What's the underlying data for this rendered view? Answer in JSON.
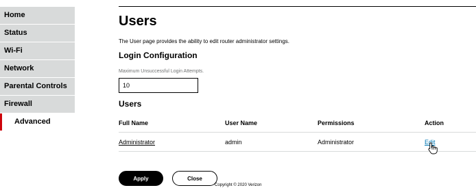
{
  "sidebar": {
    "items": [
      {
        "label": "Home"
      },
      {
        "label": "Status"
      },
      {
        "label": "Wi-Fi"
      },
      {
        "label": "Network"
      },
      {
        "label": "Parental Controls"
      },
      {
        "label": "Firewall"
      },
      {
        "label": "Advanced",
        "active": true
      }
    ]
  },
  "page": {
    "title": "Users",
    "description": "The User page provides the ability to edit router administrator settings."
  },
  "login_config": {
    "heading": "Login Configuration",
    "attempts_label": "Maximum Unsuccessful Login Attempts.",
    "attempts_value": "10"
  },
  "users": {
    "heading": "Users",
    "columns": [
      "Full Name",
      "User Name",
      "Permissions",
      "Action"
    ],
    "rows": [
      {
        "full_name": "Administrator",
        "user_name": "admin",
        "permissions": "Administrator",
        "action": "Edit"
      }
    ]
  },
  "buttons": {
    "apply": "Apply",
    "close": "Close"
  },
  "footer": {
    "copyright": "Copyright © 2020 Verizon"
  },
  "colors": {
    "accent": "#cd040b",
    "nav_bg": "#d8dada",
    "link": "#0077b4"
  },
  "icons": {
    "cursor": "hand-pointer-cursor-icon"
  }
}
